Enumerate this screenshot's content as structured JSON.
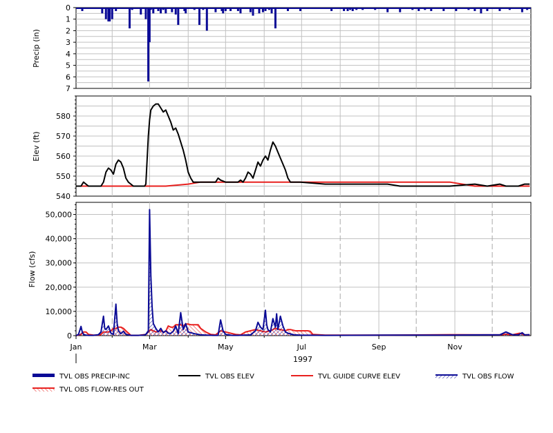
{
  "colors": {
    "precip": "#0a0a96",
    "obs_elev": "#000000",
    "guide_curve": "#e8201e",
    "obs_flow": "#0a0a96",
    "res_out": "#e8201e",
    "grid": "#c0c0c0",
    "axis": "#000000"
  },
  "chart_data": [
    {
      "type": "bar",
      "panel": "precip",
      "ylabel": "Precip (in)",
      "y_inverted": true,
      "ylim": [
        0,
        7
      ],
      "yticks": [
        "0",
        "1",
        "2",
        "3",
        "4",
        "5",
        "6",
        "7"
      ],
      "x_unit": "day of year 1997",
      "series": [
        {
          "name": "TVL OBS PRECIP-INC",
          "x": [
            5,
            12,
            21,
            24,
            26,
            27,
            29,
            32,
            43,
            45,
            52,
            56,
            58,
            59,
            60,
            62,
            66,
            68,
            70,
            72,
            77,
            80,
            82,
            87,
            88,
            95,
            99,
            102,
            105,
            112,
            117,
            118,
            120,
            124,
            130,
            132,
            140,
            142,
            147,
            150,
            152,
            155,
            157,
            160,
            170,
            175,
            180,
            205,
            215,
            218,
            220,
            222,
            225,
            230,
            240,
            250,
            260,
            265,
            270,
            275,
            280,
            285,
            295,
            305,
            315,
            320,
            325,
            330,
            340,
            348,
            350,
            358,
            362
          ],
          "values": [
            0.3,
            0.1,
            0.5,
            1.0,
            1.2,
            1.2,
            1.0,
            0.3,
            1.8,
            0.2,
            0.6,
            1.0,
            6.4,
            3.0,
            0.2,
            0.5,
            0.3,
            0.5,
            0.2,
            0.5,
            0.4,
            0.6,
            1.5,
            0.3,
            0.5,
            0.2,
            1.5,
            0.2,
            2.0,
            0.4,
            0.3,
            0.5,
            0.3,
            0.3,
            0.3,
            0.5,
            0.4,
            0.7,
            0.5,
            0.4,
            0.3,
            0.2,
            0.5,
            1.8,
            0.3,
            0.1,
            0.3,
            0.3,
            0.3,
            0.3,
            0.2,
            0.3,
            0.2,
            0.2,
            0.2,
            0.4,
            0.4,
            0.1,
            0.2,
            0.3,
            0.2,
            0.3,
            0.3,
            0.3,
            0.2,
            0.3,
            0.5,
            0.3,
            0.3,
            0.2,
            0.1,
            0.4,
            0.2
          ]
        }
      ]
    },
    {
      "type": "line",
      "panel": "elev",
      "ylabel": "Elev (ft)",
      "ylim": [
        540,
        590
      ],
      "yticks": [
        "540",
        "550",
        "560",
        "570",
        "580"
      ],
      "series": [
        {
          "name": "TVL OBS ELEV",
          "x": [
            0,
            4,
            6,
            8,
            10,
            14,
            20,
            22,
            24,
            26,
            28,
            30,
            32,
            34,
            36,
            38,
            40,
            42,
            44,
            46,
            48,
            50,
            52,
            55,
            56,
            58,
            59,
            60,
            62,
            64,
            66,
            68,
            70,
            72,
            74,
            76,
            78,
            80,
            82,
            84,
            86,
            88,
            90,
            92,
            94,
            96,
            98,
            100,
            102,
            104,
            106,
            108,
            110,
            112,
            114,
            116,
            120,
            122,
            124,
            126,
            128,
            130,
            132,
            134,
            136,
            138,
            140,
            142,
            144,
            146,
            148,
            150,
            152,
            154,
            156,
            158,
            160,
            162,
            164,
            166,
            168,
            170,
            172,
            174,
            176,
            178,
            180,
            200,
            230,
            250,
            260,
            270,
            300,
            320,
            330,
            340,
            345,
            350,
            355,
            360,
            364
          ],
          "values": [
            545,
            545,
            547,
            546,
            545,
            545,
            545,
            547,
            552,
            554,
            553,
            551,
            556,
            558,
            557,
            554,
            549,
            547,
            546,
            545,
            545,
            545,
            545,
            545,
            546,
            570,
            578,
            583,
            585,
            586,
            586,
            584,
            582,
            583,
            580,
            577,
            573,
            574,
            571,
            567,
            563,
            558,
            552,
            549,
            547,
            547,
            547,
            547,
            547,
            547,
            547,
            547,
            547,
            547,
            549,
            548,
            547,
            547,
            547,
            547,
            547,
            547,
            548,
            547,
            549,
            552,
            551,
            549,
            553,
            557,
            555,
            558,
            560,
            558,
            563,
            567,
            565,
            562,
            559,
            556,
            553,
            549,
            547,
            547,
            547,
            547,
            547,
            546,
            546,
            546,
            545,
            545,
            545,
            546,
            545,
            546,
            545,
            545,
            545,
            546,
            546
          ]
        },
        {
          "name": "TVL GUIDE CURVE ELEV",
          "x": [
            0,
            60,
            72,
            90,
            100,
            300,
            310,
            320,
            364
          ],
          "values": [
            545,
            545,
            545,
            546,
            547,
            547,
            546,
            545,
            545
          ]
        }
      ]
    },
    {
      "type": "area",
      "panel": "flow",
      "ylabel": "Flow (cfs)",
      "ylim": [
        0,
        55000
      ],
      "yticks": [
        "0",
        "10,000",
        "20,000",
        "30,000",
        "40,000",
        "50,000"
      ],
      "xticks": [
        "Jan",
        "Mar",
        "May",
        "Jul",
        "Sep",
        "Nov"
      ],
      "xtick_days": [
        0,
        59,
        120,
        181,
        243,
        304
      ],
      "year_label": "1997",
      "series": [
        {
          "name": "TVL OBS FLOW",
          "x": [
            0,
            2,
            4,
            5,
            6,
            8,
            10,
            14,
            18,
            20,
            22,
            23,
            24,
            26,
            28,
            30,
            32,
            33,
            34,
            36,
            38,
            40,
            44,
            50,
            54,
            56,
            58,
            59,
            60,
            61,
            62,
            64,
            66,
            68,
            70,
            72,
            74,
            76,
            78,
            80,
            82,
            84,
            86,
            88,
            90,
            95,
            100,
            105,
            110,
            114,
            116,
            118,
            120,
            125,
            130,
            140,
            144,
            146,
            148,
            150,
            152,
            153,
            154,
            156,
            158,
            160,
            161,
            162,
            164,
            166,
            168,
            170,
            172,
            175,
            180,
            200,
            250,
            300,
            330,
            340,
            345,
            350,
            355,
            358,
            360,
            364
          ],
          "values": [
            0,
            500,
            3800,
            1500,
            500,
            200,
            100,
            100,
            400,
            1500,
            8000,
            3000,
            2500,
            4000,
            1000,
            500,
            13000,
            5000,
            2000,
            800,
            1800,
            500,
            100,
            100,
            200,
            500,
            2000,
            52000,
            25000,
            12000,
            5000,
            3000,
            1500,
            3000,
            1200,
            2000,
            1000,
            900,
            1800,
            4000,
            800,
            9500,
            2500,
            5000,
            1500,
            800,
            300,
            200,
            100,
            100,
            6500,
            2000,
            500,
            100,
            100,
            300,
            2000,
            5500,
            3500,
            2500,
            10500,
            4500,
            2500,
            1500,
            7000,
            3500,
            9000,
            2500,
            8000,
            4000,
            1500,
            1000,
            700,
            300,
            200,
            100,
            200,
            200,
            300,
            300,
            1500,
            400,
            300,
            1200,
            300,
            400
          ]
        },
        {
          "name": "TVL OBS FLOW-RES OUT",
          "x": [
            0,
            4,
            6,
            8,
            10,
            14,
            18,
            20,
            22,
            24,
            26,
            28,
            30,
            32,
            34,
            36,
            38,
            40,
            44,
            50,
            56,
            58,
            60,
            62,
            64,
            66,
            68,
            70,
            72,
            74,
            76,
            78,
            80,
            82,
            84,
            86,
            88,
            90,
            92,
            94,
            96,
            98,
            100,
            104,
            108,
            112,
            116,
            120,
            124,
            128,
            132,
            136,
            140,
            144,
            148,
            152,
            156,
            160,
            164,
            168,
            170,
            172,
            176,
            180,
            184,
            186,
            188,
            190,
            200,
            250,
            300,
            340,
            345,
            350,
            356,
            360,
            364
          ],
          "values": [
            0,
            500,
            1500,
            1500,
            500,
            200,
            200,
            500,
            1500,
            1500,
            1500,
            2000,
            3000,
            3000,
            3500,
            3500,
            3000,
            2000,
            100,
            100,
            500,
            1500,
            2500,
            2000,
            1500,
            1800,
            2000,
            1500,
            1800,
            4000,
            3500,
            3500,
            4500,
            4500,
            4500,
            4000,
            4800,
            4800,
            4500,
            4500,
            4500,
            4500,
            3000,
            1500,
            500,
            300,
            2000,
            1500,
            1000,
            500,
            300,
            1500,
            2000,
            2500,
            2000,
            1500,
            2000,
            3000,
            2500,
            2000,
            2500,
            2500,
            2000,
            2000,
            2000,
            2000,
            1800,
            500,
            200,
            200,
            400,
            300,
            600,
            300,
            1000,
            300,
            300
          ]
        }
      ]
    }
  ],
  "legend": [
    {
      "label": "TVL OBS PRECIP-INC",
      "icon": "bar-swatch"
    },
    {
      "label": "TVL OBS ELEV",
      "icon": "line-swatch"
    },
    {
      "label": "TVL GUIDE CURVE ELEV",
      "icon": "line-swatch"
    },
    {
      "label": "TVL OBS FLOW",
      "icon": "hatched-swatch"
    },
    {
      "label": "TVL OBS FLOW-RES OUT",
      "icon": "hatched-swatch"
    }
  ]
}
